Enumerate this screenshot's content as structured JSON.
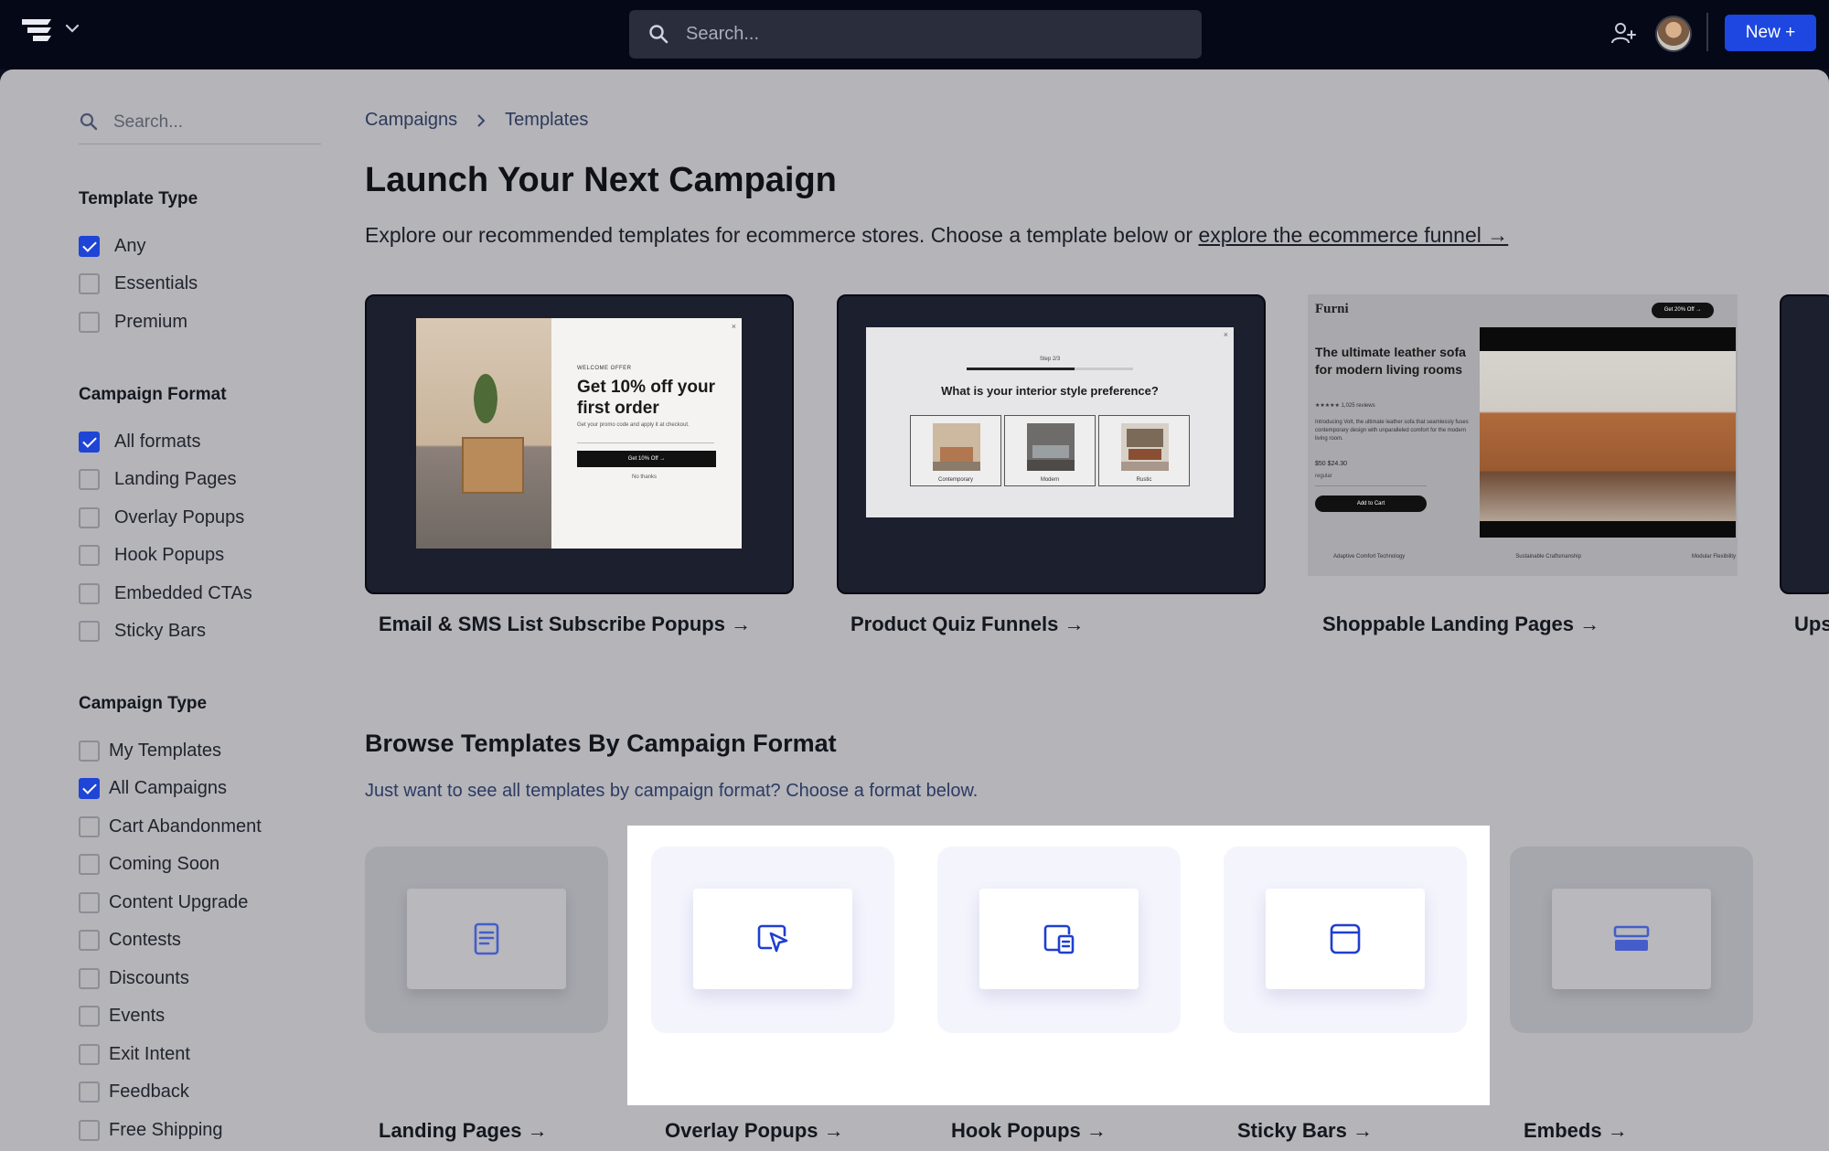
{
  "topbar": {
    "search_placeholder": "Search...",
    "new_button": "New +"
  },
  "sidebar": {
    "search_placeholder": "Search...",
    "template_type": {
      "heading": "Template Type",
      "options": [
        {
          "label": "Any",
          "checked": true
        },
        {
          "label": "Essentials",
          "checked": false
        },
        {
          "label": "Premium",
          "checked": false
        }
      ]
    },
    "campaign_format": {
      "heading": "Campaign Format",
      "options": [
        {
          "label": "All formats",
          "checked": true
        },
        {
          "label": "Landing Pages",
          "checked": false
        },
        {
          "label": "Overlay Popups",
          "checked": false
        },
        {
          "label": "Hook Popups",
          "checked": false
        },
        {
          "label": "Embedded CTAs",
          "checked": false
        },
        {
          "label": "Sticky Bars",
          "checked": false
        }
      ]
    },
    "campaign_type": {
      "heading": "Campaign Type",
      "options": [
        {
          "label": "My Templates",
          "checked": false
        },
        {
          "label": "All Campaigns",
          "checked": true
        },
        {
          "label": "Cart Abandonment",
          "checked": false
        },
        {
          "label": "Coming Soon",
          "checked": false
        },
        {
          "label": "Content Upgrade",
          "checked": false
        },
        {
          "label": "Contests",
          "checked": false
        },
        {
          "label": "Discounts",
          "checked": false
        },
        {
          "label": "Events",
          "checked": false
        },
        {
          "label": "Exit Intent",
          "checked": false
        },
        {
          "label": "Feedback",
          "checked": false
        },
        {
          "label": "Free Shipping",
          "checked": false
        }
      ]
    }
  },
  "breadcrumb": [
    "Campaigns",
    "Templates"
  ],
  "main": {
    "title": "Launch Your Next Campaign",
    "subtitle": "Explore our recommended templates for ecommerce stores. Choose a template below or ",
    "subtitle_link": "explore the ecommerce funnel →"
  },
  "featured": [
    {
      "label": "Email & SMS List Subscribe Popups →"
    },
    {
      "label": "Product Quiz Funnels →"
    },
    {
      "label": "Shoppable Landing Pages →"
    },
    {
      "label": "Ups"
    }
  ],
  "preview_popup": {
    "small": "WELCOME OFFER",
    "headline": "Get 10% off your first order",
    "tiny": "Get your promo code and apply it at checkout.",
    "button": "Get 10% Off →",
    "decline": "No thanks",
    "close": "×"
  },
  "preview_quiz": {
    "step": "Step 2/3",
    "question": "What is your interior style preference?",
    "options": [
      "Contemporary",
      "Modern",
      "Rustic"
    ],
    "close": "×"
  },
  "preview_landing": {
    "brand": "Furni",
    "pill": "Get 20% Off →",
    "headline": "The ultimate leather sofa for modern living rooms",
    "stars": "★★★★★ 1,025 reviews",
    "description": "Introducing Volt, the ultimate leather sofa that seamlessly fuses contemporary design with unparalleled comfort for the modern living room.",
    "price": "$50 $24.30",
    "select": "regular",
    "cta": "Add to Cart",
    "features": [
      "Adaptive Comfort Technology",
      "Sustainable Craftsmanship",
      "Modular Flexibility"
    ]
  },
  "browse": {
    "title": "Browse Templates By Campaign Format",
    "subtitle": "Just want to see all templates by campaign format? Choose a format below."
  },
  "formats": [
    {
      "label": "Landing Pages →",
      "icon": "document-icon",
      "highlighted": false
    },
    {
      "label": "Overlay Popups →",
      "icon": "cursor-popup-icon",
      "highlighted": true
    },
    {
      "label": "Hook Popups →",
      "icon": "hook-popup-icon",
      "highlighted": true
    },
    {
      "label": "Sticky Bars →",
      "icon": "browser-window-icon",
      "highlighted": true
    },
    {
      "label": "Embeds →",
      "icon": "embed-block-icon",
      "highlighted": false
    }
  ],
  "colors": {
    "accent": "#1d47e0",
    "topbar": "#050817",
    "overlay_dim": "#b4b4b9",
    "highlight": "#ffffff"
  }
}
